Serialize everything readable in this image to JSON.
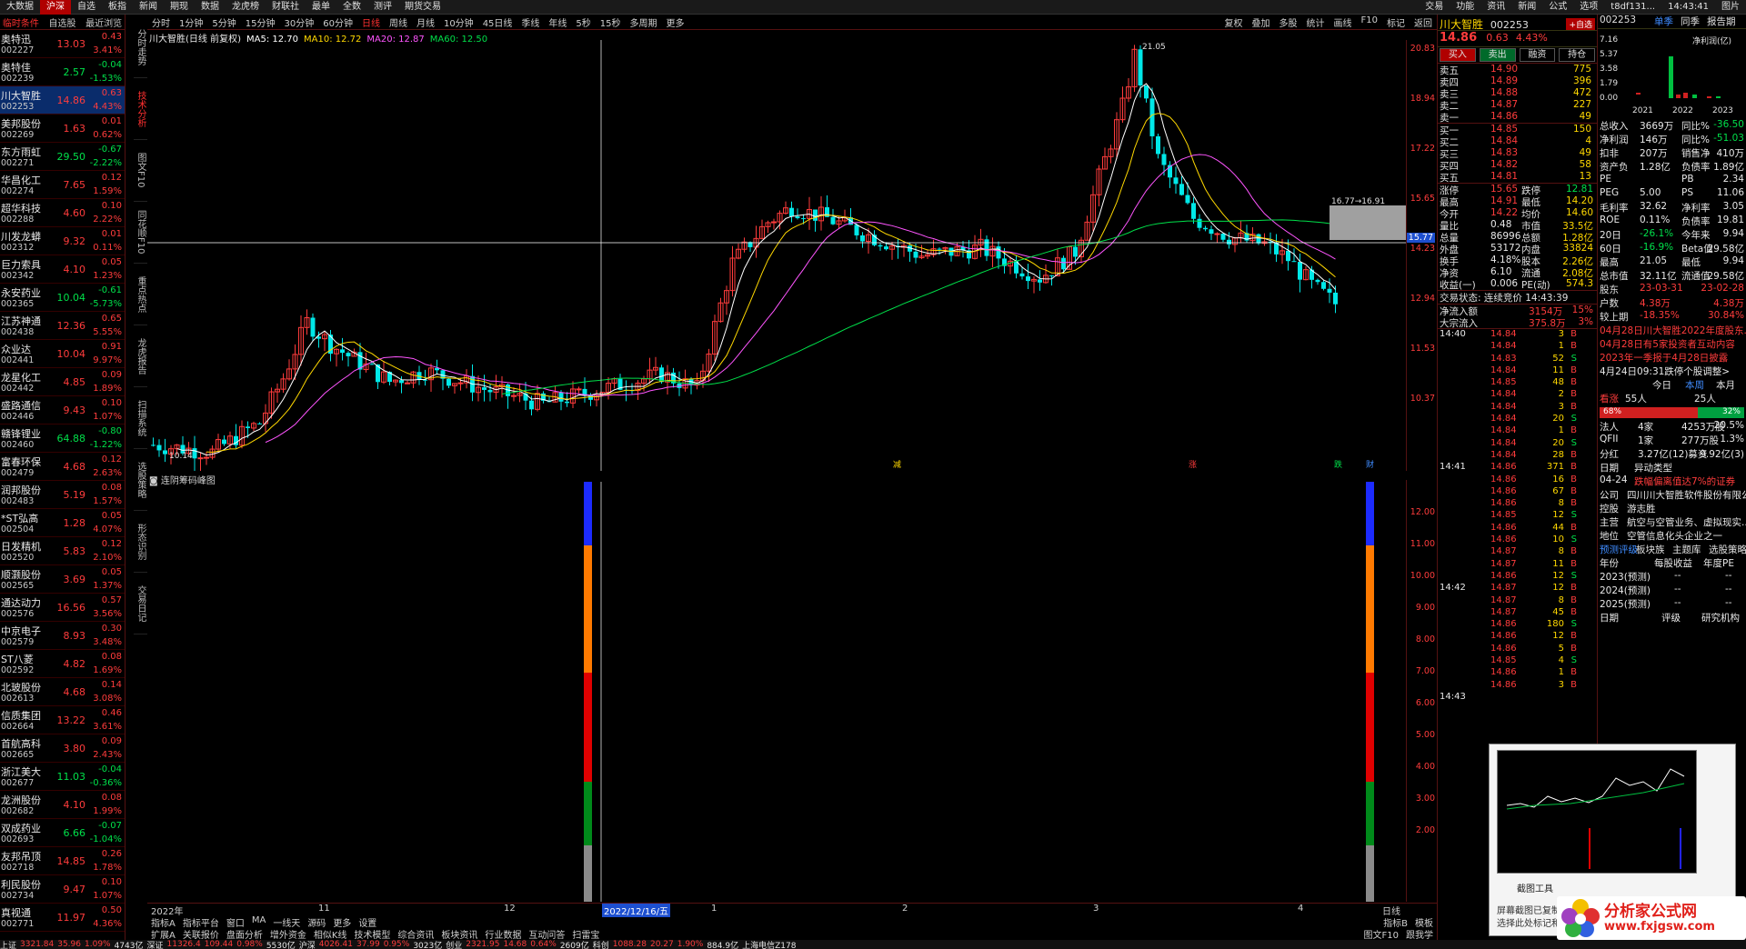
{
  "menubar": {
    "left": [
      "大数据",
      "沪深",
      "自选",
      "板指",
      "新闻",
      "期现",
      "数据",
      "龙虎榜",
      "财联社",
      "最单",
      "全数",
      "测评",
      "期货交易"
    ],
    "right": [
      "交易",
      "功能",
      "资讯",
      "新闻",
      "公式",
      "选项",
      "t8df131...",
      "14:43:41",
      "图片"
    ]
  },
  "leftpanel": {
    "header": [
      "临时条件",
      "自选股",
      "最近浏览"
    ],
    "stocks": [
      {
        "name": "奥特迅",
        "code": "002227",
        "price": "13.03",
        "change": "0.43",
        "pct": "3.41%",
        "dir": "up"
      },
      {
        "name": "奥特佳",
        "code": "002239",
        "price": "2.57",
        "change": "-0.04",
        "pct": "-1.53%",
        "dir": "dn"
      },
      {
        "name": "川大智胜",
        "code": "002253",
        "price": "14.86",
        "change": "0.63",
        "pct": "4.43%",
        "dir": "up"
      },
      {
        "name": "美邦股份",
        "code": "002269",
        "price": "1.63",
        "change": "0.01",
        "pct": "0.62%",
        "dir": "up"
      },
      {
        "name": "东方雨虹",
        "code": "002271",
        "price": "29.50",
        "change": "-0.67",
        "pct": "-2.22%",
        "dir": "dn"
      },
      {
        "name": "华昌化工",
        "code": "002274",
        "price": "7.65",
        "change": "0.12",
        "pct": "1.59%",
        "dir": "up"
      },
      {
        "name": "超华科技",
        "code": "002288",
        "price": "4.60",
        "change": "0.10",
        "pct": "2.22%",
        "dir": "up"
      },
      {
        "name": "川发龙蟒",
        "code": "002312",
        "price": "9.32",
        "change": "0.01",
        "pct": "0.11%",
        "dir": "up"
      },
      {
        "name": "巨力索具",
        "code": "002342",
        "price": "4.10",
        "change": "0.05",
        "pct": "1.23%",
        "dir": "up"
      },
      {
        "name": "永安药业",
        "code": "002365",
        "price": "10.04",
        "change": "-0.61",
        "pct": "-5.73%",
        "dir": "dn"
      },
      {
        "name": "江苏神通",
        "code": "002438",
        "price": "12.36",
        "change": "0.65",
        "pct": "5.55%",
        "dir": "up"
      },
      {
        "name": "众业达",
        "code": "002441",
        "price": "10.04",
        "change": "0.91",
        "pct": "9.97%",
        "dir": "up"
      },
      {
        "name": "龙星化工",
        "code": "002442",
        "price": "4.85",
        "change": "0.09",
        "pct": "1.89%",
        "dir": "up"
      },
      {
        "name": "盛路通信",
        "code": "002446",
        "price": "9.43",
        "change": "0.10",
        "pct": "1.07%",
        "dir": "up"
      },
      {
        "name": "赣锋锂业",
        "code": "002460",
        "price": "64.88",
        "change": "-0.80",
        "pct": "-1.22%",
        "dir": "dn"
      },
      {
        "name": "富春环保",
        "code": "002479",
        "price": "4.68",
        "change": "0.12",
        "pct": "2.63%",
        "dir": "up"
      },
      {
        "name": "润邦股份",
        "code": "002483",
        "price": "5.19",
        "change": "0.08",
        "pct": "1.57%",
        "dir": "up"
      },
      {
        "name": "*ST弘高",
        "code": "002504",
        "price": "1.28",
        "change": "0.05",
        "pct": "4.07%",
        "dir": "up"
      },
      {
        "name": "日发精机",
        "code": "002520",
        "price": "5.83",
        "change": "0.12",
        "pct": "2.10%",
        "dir": "up"
      },
      {
        "name": "顺灏股份",
        "code": "002565",
        "price": "3.69",
        "change": "0.05",
        "pct": "1.37%",
        "dir": "up"
      },
      {
        "name": "通达动力",
        "code": "002576",
        "price": "16.56",
        "change": "0.57",
        "pct": "3.56%",
        "dir": "up"
      },
      {
        "name": "中京电子",
        "code": "002579",
        "price": "8.93",
        "change": "0.30",
        "pct": "3.48%",
        "dir": "up"
      },
      {
        "name": "ST八菱",
        "code": "002592",
        "price": "4.82",
        "change": "0.08",
        "pct": "1.69%",
        "dir": "up"
      },
      {
        "name": "北玻股份",
        "code": "002613",
        "price": "4.68",
        "change": "0.14",
        "pct": "3.08%",
        "dir": "up"
      },
      {
        "name": "信质集团",
        "code": "002664",
        "price": "13.22",
        "change": "0.46",
        "pct": "3.61%",
        "dir": "up"
      },
      {
        "name": "首航高科",
        "code": "002665",
        "price": "3.80",
        "change": "0.09",
        "pct": "2.43%",
        "dir": "up"
      },
      {
        "name": "浙江美大",
        "code": "002677",
        "price": "11.03",
        "change": "-0.04",
        "pct": "-0.36%",
        "dir": "dn"
      },
      {
        "name": "龙洲股份",
        "code": "002682",
        "price": "4.10",
        "change": "0.08",
        "pct": "1.99%",
        "dir": "up"
      },
      {
        "name": "双成药业",
        "code": "002693",
        "price": "6.66",
        "change": "-0.07",
        "pct": "-1.04%",
        "dir": "dn"
      },
      {
        "name": "友邦吊顶",
        "code": "002718",
        "price": "14.85",
        "change": "0.26",
        "pct": "1.78%",
        "dir": "up"
      },
      {
        "name": "利民股份",
        "code": "002734",
        "price": "9.47",
        "change": "0.10",
        "pct": "1.07%",
        "dir": "up"
      },
      {
        "name": "真视通",
        "code": "002771",
        "price": "11.97",
        "change": "0.50",
        "pct": "4.36%",
        "dir": "up"
      }
    ]
  },
  "vtabs": [
    "分时走势",
    "技术分析",
    "图文F10",
    "同花顺F10",
    "重点热点",
    "龙虎报告",
    "扫描系统",
    "选股策略",
    "形态识别",
    "交易日记"
  ],
  "chart_toolbar": {
    "periods": [
      "分时",
      "1分钟",
      "5分钟",
      "15分钟",
      "30分钟",
      "60分钟",
      "日线",
      "周线",
      "月线",
      "10分钟",
      "45日线",
      "季线",
      "年线",
      "5秒",
      "15秒",
      "多周期",
      "更多"
    ],
    "active": "日线",
    "right": [
      "复权",
      "叠加",
      "多股",
      "统计",
      "画线",
      "F10",
      "标记",
      "返回"
    ]
  },
  "ma_legend": {
    "title": "川大智胜(日线 前复权)",
    "items": [
      {
        "label": "MA5: 12.70",
        "color": "#ffffff"
      },
      {
        "label": "MA10: 12.72",
        "color": "#ffd800"
      },
      {
        "label": "MA20: 12.87",
        "color": "#ff55ff"
      },
      {
        "label": "MA60: 12.50",
        "color": "#00e04a"
      }
    ]
  },
  "chart_labels": {
    "high": "21.05",
    "low": "10.14",
    "box_text": "16.77→16.91",
    "crosshair_price": "15.77",
    "crosshair_date": "2022/12/16/五"
  },
  "chart_markers": [
    "减",
    "涨",
    "跌",
    "财"
  ],
  "price_axis": [
    "20.83",
    "18.94",
    "17.22",
    "15.65",
    "14.23",
    "12.94",
    "11.53",
    "10.37"
  ],
  "sub_indicator": {
    "title": "连阴筹码峰图"
  },
  "sub_axis": [
    "12.00",
    "11.00",
    "10.00",
    "9.00",
    "8.00",
    "7.00",
    "6.00",
    "5.00",
    "4.00",
    "3.00",
    "2.00"
  ],
  "date_axis": [
    "2022年",
    "11",
    "12",
    "2022/12/16/五",
    "1",
    "2",
    "3",
    "4"
  ],
  "date_axis_right": "日线",
  "bottom_tabs": [
    "指标A",
    "指标平台",
    "窗口",
    "MA",
    "一线天",
    "源码",
    "更多",
    "设置"
  ],
  "bottom_tabs_right": [
    "指标B",
    "模板"
  ],
  "bottom_tabs2": [
    "扩展A",
    "关联报价",
    "盘面分析",
    "增外资金",
    "相似K线",
    "技术模型",
    "综合资讯",
    "板块资讯",
    "行业数据",
    "互动问答",
    "扫雷宝"
  ],
  "bottom_tabs2_right": [
    "图文F10",
    "跟我学"
  ],
  "statusbar": [
    {
      "t": "上证",
      "c": "wh"
    },
    {
      "t": "3321.84",
      "c": "up"
    },
    {
      "t": "35.96",
      "c": "up"
    },
    {
      "t": "1.09%",
      "c": "up"
    },
    {
      "t": "4743亿",
      "c": "wh"
    },
    {
      "t": "深证",
      "c": "wh"
    },
    {
      "t": "11326.4",
      "c": "up"
    },
    {
      "t": "109.44",
      "c": "up"
    },
    {
      "t": "0.98%",
      "c": "up"
    },
    {
      "t": "5530亿",
      "c": "wh"
    },
    {
      "t": "沪深",
      "c": "wh"
    },
    {
      "t": "4026.41",
      "c": "up"
    },
    {
      "t": "37.99",
      "c": "up"
    },
    {
      "t": "0.95%",
      "c": "up"
    },
    {
      "t": "3023亿",
      "c": "wh"
    },
    {
      "t": "创业",
      "c": "wh"
    },
    {
      "t": "2321.95",
      "c": "up"
    },
    {
      "t": "14.68",
      "c": "up"
    },
    {
      "t": "0.64%",
      "c": "up"
    },
    {
      "t": "2609亿",
      "c": "wh"
    },
    {
      "t": "科创",
      "c": "wh"
    },
    {
      "t": "1088.28",
      "c": "up"
    },
    {
      "t": "20.27",
      "c": "up"
    },
    {
      "t": "1.90%",
      "c": "up"
    },
    {
      "t": "884.9亿",
      "c": "wh"
    },
    {
      "t": "上海电信Z178",
      "c": "wh"
    }
  ],
  "rp1": {
    "name": "川大智胜",
    "code": "002253",
    "badge": "+自选",
    "price": "14.86",
    "change": "0.63",
    "pct": "4.43%",
    "buttons": [
      "买入",
      "卖出",
      "融资",
      "持仓"
    ],
    "sells": [
      [
        "卖五",
        "14.90",
        "775"
      ],
      [
        "卖四",
        "14.89",
        "396"
      ],
      [
        "卖三",
        "14.88",
        "472"
      ],
      [
        "卖二",
        "14.87",
        "227"
      ],
      [
        "卖一",
        "14.86",
        "49"
      ]
    ],
    "buys": [
      [
        "买一",
        "14.85",
        "150"
      ],
      [
        "买二",
        "14.84",
        "4"
      ],
      [
        "买三",
        "14.83",
        "49"
      ],
      [
        "买四",
        "14.82",
        "58"
      ],
      [
        "买五",
        "14.81",
        "13"
      ]
    ],
    "stats": [
      [
        "涨停",
        "15.65",
        "跌停",
        "12.81"
      ],
      [
        "最高",
        "14.91",
        "最低",
        "14.20"
      ],
      [
        "今开",
        "14.22",
        "均价",
        "14.60"
      ],
      [
        "量比",
        "0.48",
        "市值",
        "33.5亿"
      ],
      [
        "总量",
        "86996",
        "总额",
        "1.28亿"
      ],
      [
        "外盘",
        "53172",
        "内盘",
        "33824"
      ],
      [
        "换手",
        "4.18%",
        "股本",
        "2.26亿"
      ],
      [
        "净资",
        "6.10",
        "流通",
        "2.08亿"
      ],
      [
        "收益(一)",
        "0.006",
        "PE(动)",
        "574.3"
      ]
    ],
    "trade_status": "交易状态: 连续竞价 14:43:39",
    "flow": [
      [
        "净流入额",
        "3154万",
        "15%"
      ],
      [
        "大宗流入",
        "375.8万",
        "3%"
      ]
    ],
    "ticks": [
      [
        "14:40",
        "14.84",
        "3",
        "B"
      ],
      [
        "",
        "14.84",
        "1",
        "B"
      ],
      [
        "",
        "14.83",
        "52",
        "S"
      ],
      [
        "",
        "14.84",
        "11",
        "B"
      ],
      [
        "",
        "14.85",
        "48",
        "B"
      ],
      [
        "",
        "14.84",
        "2",
        "B"
      ],
      [
        "",
        "14.84",
        "3",
        "B"
      ],
      [
        "",
        "14.84",
        "20",
        "S"
      ],
      [
        "",
        "14.84",
        "1",
        "B"
      ],
      [
        "",
        "14.84",
        "20",
        "S"
      ],
      [
        "",
        "14.84",
        "28",
        "B"
      ],
      [
        "14:41",
        "14.86",
        "371",
        "B"
      ],
      [
        "",
        "14.86",
        "16",
        "B"
      ],
      [
        "",
        "14.86",
        "67",
        "B"
      ],
      [
        "",
        "14.86",
        "8",
        "B"
      ],
      [
        "",
        "14.85",
        "12",
        "S"
      ],
      [
        "",
        "14.86",
        "44",
        "B"
      ],
      [
        "",
        "14.86",
        "10",
        "S"
      ],
      [
        "",
        "14.87",
        "8",
        "B"
      ],
      [
        "",
        "14.87",
        "11",
        "B"
      ],
      [
        "",
        "14.86",
        "12",
        "S"
      ],
      [
        "14:42",
        "14.87",
        "12",
        "B"
      ],
      [
        "",
        "14.87",
        "8",
        "B"
      ],
      [
        "",
        "14.87",
        "45",
        "B"
      ],
      [
        "",
        "14.86",
        "180",
        "S"
      ],
      [
        "",
        "14.86",
        "12",
        "B"
      ],
      [
        "",
        "14.86",
        "5",
        "B"
      ],
      [
        "",
        "14.85",
        "4",
        "S"
      ],
      [
        "",
        "14.86",
        "1",
        "B"
      ],
      [
        "",
        "14.86",
        "3",
        "B"
      ],
      [
        "14:43",
        "",
        "",
        ""
      ]
    ]
  },
  "rp2": {
    "code": "002253",
    "tabs": [
      "单季",
      "同季",
      "报告期"
    ],
    "bar_axis": [
      "7.16",
      "5.37",
      "3.58",
      "1.79",
      "0.00"
    ],
    "bar_years": [
      "2021",
      "2022",
      "2023"
    ],
    "bar_label": "净利润(亿)",
    "fund": [
      [
        "总收入",
        "3669万",
        "同比%",
        "-36.50"
      ],
      [
        "净利润",
        "146万",
        "同比%",
        "-51.03"
      ],
      [
        "扣非",
        "207万",
        "销售净",
        "410万"
      ],
      [
        "资产负",
        "1.28亿",
        "负债率",
        "1.89亿"
      ],
      [
        "PE",
        "",
        "PB",
        "2.34"
      ],
      [
        "PEG",
        "5.00",
        "PS",
        "11.06"
      ],
      [
        "毛利率",
        "32.62",
        "净利率",
        "3.05"
      ],
      [
        "ROE",
        "0.11%",
        "负债率",
        "19.81"
      ],
      [
        "20日",
        "-26.1%",
        "今年来",
        "9.94"
      ],
      [
        "60日",
        "-16.9%",
        "Beta值",
        "29.58亿"
      ],
      [
        "最高",
        "21.05",
        "最低",
        "9.94"
      ],
      [
        "总市值",
        "32.11亿",
        "流通值",
        "29.58亿"
      ],
      [
        "股东",
        "23-03-31",
        "",
        "23-02-28"
      ],
      [
        "户数",
        "4.38万",
        "",
        "4.38万"
      ],
      [
        "较上期",
        "-18.35%",
        "",
        "30.84%"
      ]
    ],
    "news": [
      "04月28日川大智胜2022年度股东...",
      "04月28日有5家投资者互动内容",
      "2023年一季报于4月28日披露"
    ],
    "news2": "4月24日09:31跌停个股调整>",
    "sentiment": {
      "label": "看涨",
      "today": "今日",
      "main": "本周",
      "month": "本月",
      "label2": "本月",
      "count1": "55人",
      "count2": "25人",
      "red": "68%",
      "green": "32%"
    },
    "holders": [
      [
        "法人",
        "4家",
        "4253万股",
        "20.5%"
      ],
      [
        "QFII",
        "1家",
        "277万股",
        "1.3%"
      ],
      [
        "分红",
        "3.27亿(12)募资",
        "",
        "9.92亿(3)"
      ]
    ],
    "events": [
      [
        "日期",
        "异动类型"
      ],
      [
        "04-24",
        "跌幅偏离值达7%的证券"
      ]
    ],
    "company": [
      [
        "公司",
        "四川川大智胜软件股份有限公司"
      ],
      [
        "控股",
        "游志胜"
      ],
      [
        "主营",
        "航空与空管业务、虚拟现实..."
      ],
      [
        "地位",
        "空管信息化头企业之一"
      ]
    ],
    "tabs2": [
      "预测评级",
      "板块族",
      "主题库",
      "选股策略"
    ],
    "forecast_head": [
      "年份",
      "每股收益",
      "年度PE"
    ],
    "forecast": [
      [
        "2023(预测)",
        "--",
        "--"
      ],
      [
        "2024(预测)",
        "--",
        "--"
      ],
      [
        "2025(预测)",
        "--",
        "--"
      ]
    ],
    "rating_head": [
      "日期",
      "评级",
      "研究机构"
    ]
  },
  "popup": {
    "title": "截图工具",
    "msg1": "屏幕截图已复制到剪贴板",
    "msg2": "选择此处标记和共享图像"
  },
  "watermark": {
    "line1": "分析家公式网",
    "line2": "www.fxjgsw.com"
  }
}
